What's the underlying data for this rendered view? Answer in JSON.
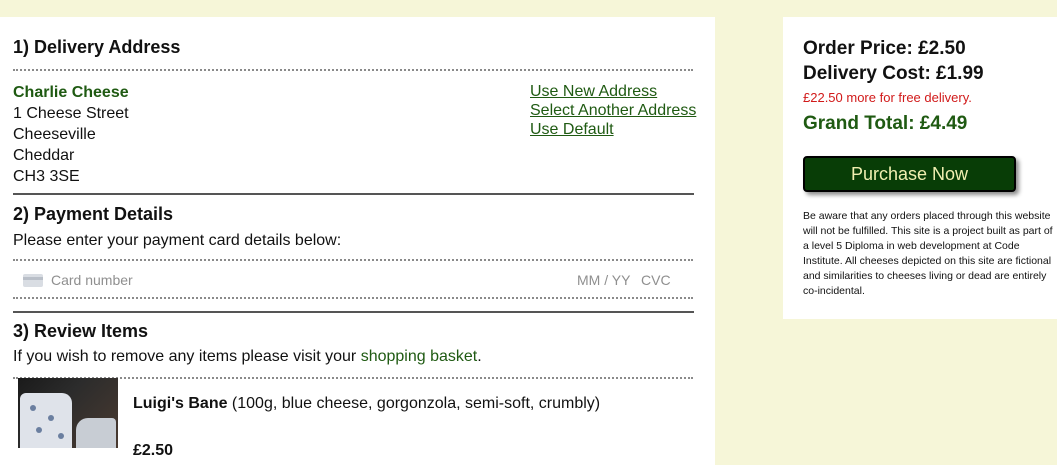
{
  "delivery": {
    "title": "1) Delivery Address",
    "name": "Charlie Cheese",
    "lines": [
      "1 Cheese Street",
      "Cheeseville",
      "Cheddar",
      "CH3 3SE"
    ],
    "links": [
      "Use New Address",
      "Select Another Address",
      "Use Default"
    ]
  },
  "payment": {
    "title": "2) Payment Details",
    "instructions": "Please enter your payment card details below:",
    "card_placeholder": "Card number",
    "expiry_placeholder": "MM / YY",
    "cvc_placeholder": "CVC"
  },
  "review": {
    "title": "3) Review Items",
    "instructions_prefix": "If you wish to remove any items please visit your ",
    "basket_link": "shopping basket",
    "instructions_suffix": ".",
    "items": [
      {
        "name": "Luigi's Bane",
        "details": " (100g, blue cheese, gorgonzola, semi-soft, crumbly)",
        "price": "£2.50"
      }
    ]
  },
  "summary": {
    "order_price": "Order Price: £2.50",
    "delivery_cost": "Delivery Cost: £1.99",
    "free_delivery_note": "£22.50 more for free delivery.",
    "grand_total": "Grand Total: £4.49",
    "purchase_label": "Purchase Now",
    "disclaimer": "Be aware that any orders placed through this website will not be fulfilled. This site is a project built as part of a level 5 Diploma in web development at Code Institute. All cheeses depicted on this site are fictional and similarities to cheeses living or dead are entirely co-incidental."
  },
  "colors": {
    "page_background": "#f6f6d8",
    "accent_green": "#1f5a12",
    "button_background": "#083d06",
    "button_text": "#f0efb0",
    "warning_red": "#d11a1a"
  },
  "icons": [
    "card-icon",
    "cheese-image"
  ]
}
